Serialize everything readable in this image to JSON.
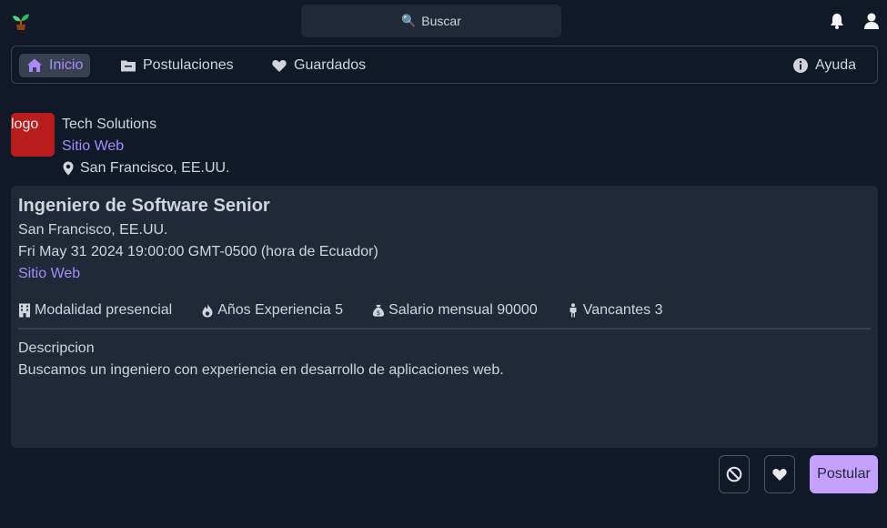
{
  "header": {
    "search_label": "Buscar"
  },
  "nav": {
    "items": [
      {
        "label": "Inicio",
        "icon": "home-icon"
      },
      {
        "label": "Postulaciones",
        "icon": "folder-icon"
      },
      {
        "label": "Guardados",
        "icon": "heart-icon"
      }
    ],
    "help_label": "Ayuda"
  },
  "company": {
    "logo_text": "logo",
    "name": "Tech Solutions",
    "website": "Sitio Web",
    "location": "San Francisco, EE.UU."
  },
  "job": {
    "title": "Ingeniero de Software Senior",
    "location": "San Francisco, EE.UU.",
    "date": "Fri May 31 2024 19:00:00 GMT-0500 (hora de Ecuador)",
    "website": "Sitio Web",
    "features": {
      "modality": "Modalidad presencial",
      "experience": "Años Experiencia 5",
      "salary": "Salario mensual 90000",
      "vacancies": "Vancantes 3"
    },
    "description_label": "Descripcion",
    "description": "Buscamos un ingeniero con experiencia en desarrollo de aplicaciones web."
  },
  "actions": {
    "apply_label": "Postular"
  },
  "colors": {
    "background": "#111827",
    "card": "#1f2937",
    "accent": "#a78bfa",
    "apply_button": "#c4a0ff",
    "company_logo": "#b91c1c"
  }
}
